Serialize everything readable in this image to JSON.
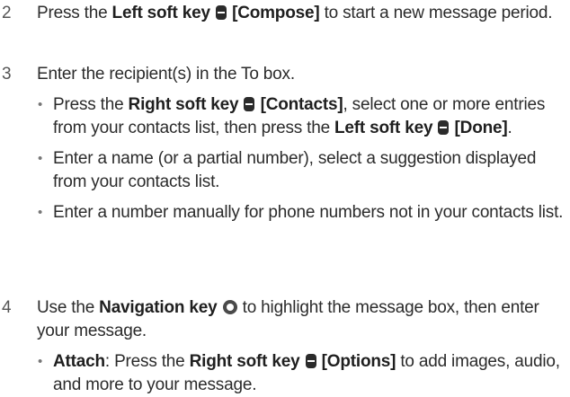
{
  "step2": {
    "number": "2",
    "t1": "Press the ",
    "key": "Left soft key",
    "label": "[Compose]",
    "t2": " to start a new message period."
  },
  "step3": {
    "number": "3",
    "text": "Enter the recipient(s) in the To box.",
    "b1": {
      "t1": "Press the ",
      "key1": "Right soft key",
      "label1": "[Contacts]",
      "t2": ", select one or more entries from your contacts list, then press the ",
      "key2": "Left soft key",
      "label2": "[Done]",
      "t3": "."
    },
    "b2": "Enter a name (or a partial number), select a suggestion displayed from your contacts list.",
    "b3": "Enter a number manually for phone numbers not in your contacts list."
  },
  "step4": {
    "number": "4",
    "t1": "Use the ",
    "key": "Navigation key",
    "t2": " to highlight the message box, then enter your message.",
    "b1": {
      "term": "Attach",
      "t1": ": Press the ",
      "key": "Right soft key",
      "label": "[Options]",
      "t2": " to add images, audio, and more to your message."
    }
  },
  "bullet_char": "•"
}
